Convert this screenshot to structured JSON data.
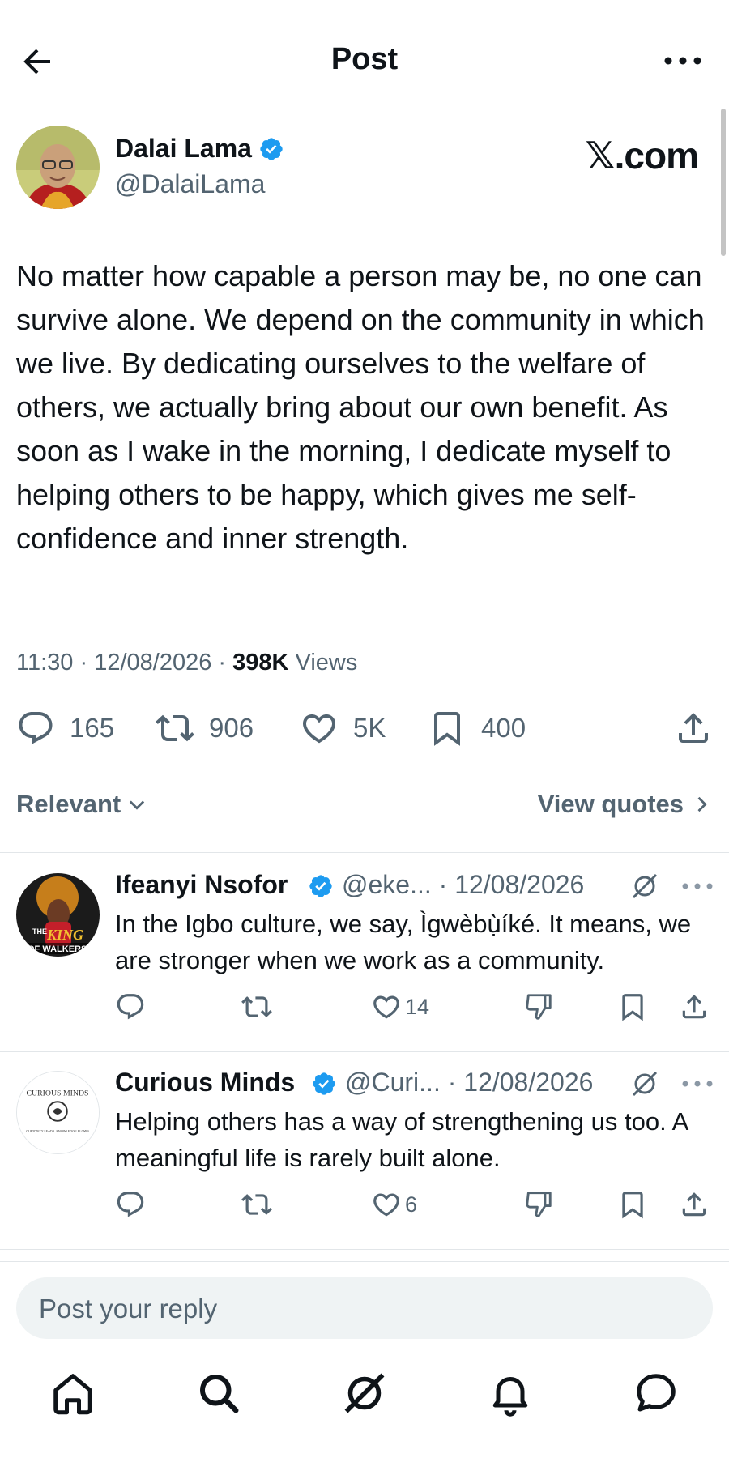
{
  "header": {
    "title": "Post",
    "back_icon": "arrow-left-icon",
    "more_icon": "more-horizontal-icon"
  },
  "post": {
    "author_name": "Dalai Lama",
    "author_handle": "@DalaiLama",
    "verified": true,
    "source_logo": "𝕏.com",
    "text": "No matter how capable a person may be, no one can survive alone. We depend on the community in which we live. By dedicating ourselves to the welfare of others, we actually bring about our own benefit. As soon as I wake in the morning, I dedicate myself to helping others to be happy, which gives me self-confidence and inner strength.",
    "time": "11:30",
    "date": "12/08/2026",
    "views_count": "398K",
    "views_label": "Views",
    "replies": "165",
    "reposts": "906",
    "likes": "5K",
    "bookmarks": "400"
  },
  "filters": {
    "sort_label": "Relevant",
    "view_quotes_label": "View quotes"
  },
  "replies": [
    {
      "name": "Ifeanyi Nsofor",
      "handle": "@eke...",
      "date": "12/08/2026",
      "verified": true,
      "avatar_caption_top": "THE",
      "avatar_caption_mid": "KING",
      "avatar_caption_bottom": "OF WALKERS",
      "text": "In the Igbo culture, we say, Ìgwèbụ̀íké. It means, we are stronger when we work as a community.",
      "likes": "14"
    },
    {
      "name": "Curious Minds",
      "handle": "@Curi...",
      "date": "12/08/2026",
      "verified": true,
      "avatar_caption_top": "CURIOUS MINDS",
      "avatar_caption_bottom": "CURIOSITY LEADS, KNOWLEDGE FLOWS",
      "text": "Helping others has a way of strengthening us too. A meaningful life is rarely built alone.",
      "likes": "6"
    }
  ],
  "composer": {
    "placeholder": "Post your reply"
  },
  "tabbar": {
    "items": [
      "home-icon",
      "search-icon",
      "grok-icon",
      "notifications-icon",
      "messages-icon"
    ]
  },
  "colors": {
    "text": "#0f1419",
    "secondary": "#536471",
    "verified": "#1d9bf0",
    "composer_bg": "#eff3f4"
  }
}
